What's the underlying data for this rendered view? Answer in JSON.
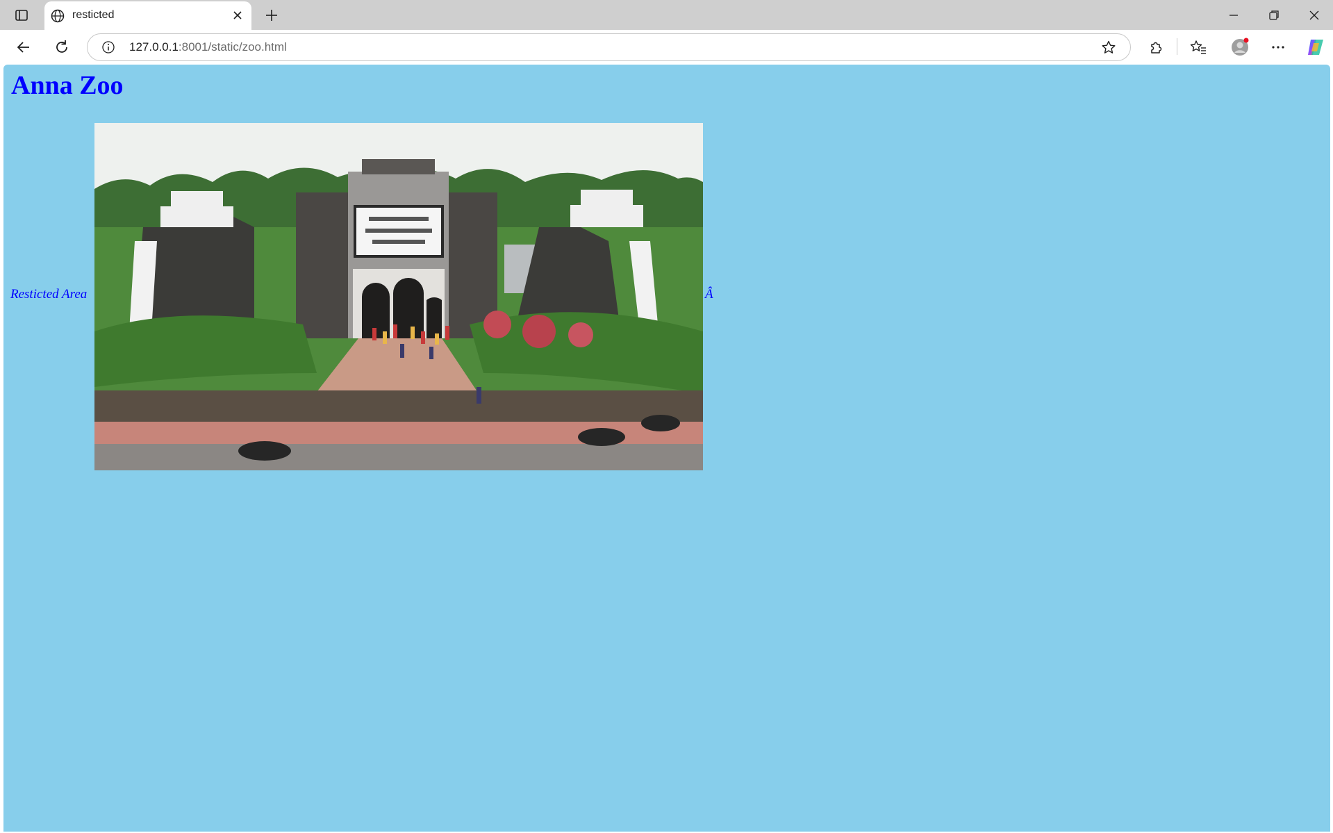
{
  "browser": {
    "tab_title": "resticted",
    "url_host": "127.0.0.1",
    "url_rest": ":8001/static/zoo.html"
  },
  "page": {
    "heading": "Anna Zoo",
    "link_text": "Resticted Area",
    "trailing_char": "Â",
    "background_color": "#87ceeb",
    "text_color": "#0000ff"
  }
}
